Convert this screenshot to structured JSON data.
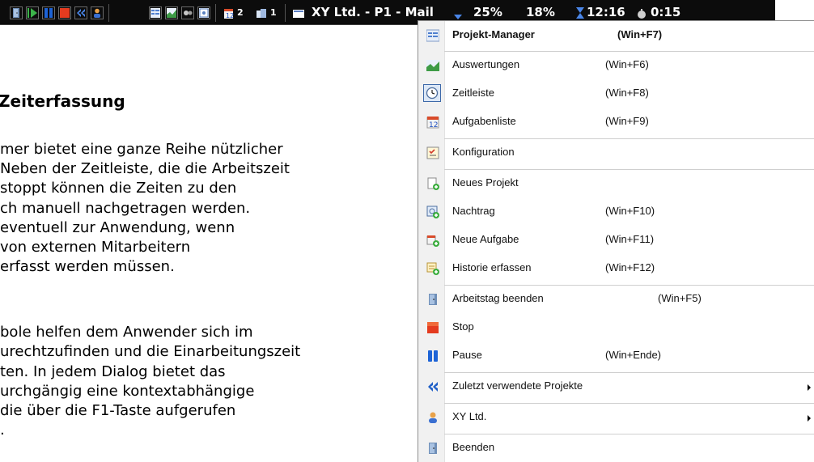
{
  "taskbar": {
    "buttons": [
      "door-icon",
      "play-icon",
      "pause-icon",
      "stop-icon",
      "rewind-icon",
      "person-icon",
      "project-manager-icon",
      "chart-icon",
      "tools-icon",
      "timeline-icon"
    ],
    "tasks_count": "2",
    "projects_count": "1",
    "project_title": "XY Ltd. - P1 - Mail",
    "percent_1": "25%",
    "percent_2": "18%",
    "clock_1": "12:16",
    "clock_2": "0:15"
  },
  "document": {
    "heading": "Zeiterfassung",
    "lines": [
      "mer bietet eine ganze Reihe nützlicher",
      "Neben der Zeitleiste, die die Arbeitszeit",
      "stoppt können die Zeiten zu den",
      "ch manuell nachgetragen werden.",
      "eventuell zur Anwendung, wenn",
      " von externen Mitarbeitern",
      "erfasst werden müssen.",
      "bole helfen dem Anwender sich im",
      "urechtzufinden und die Einarbeitungszeit",
      "ten. In jedem Dialog bietet das",
      "urchgängig eine kontextabhängige",
      " die über die F1-Taste aufgerufen",
      "."
    ]
  },
  "menu": {
    "items": [
      {
        "label": "Projekt-Manager",
        "shortcut": "(Win+F7)",
        "icon": "project-manager-icon",
        "bold": true
      },
      {
        "label": "Auswertungen",
        "shortcut": "(Win+F6)",
        "icon": "chart-icon"
      },
      {
        "label": "Zeitleiste",
        "shortcut": "(Win+F8)",
        "icon": "clock-icon"
      },
      {
        "label": "Aufgabenliste",
        "shortcut": "(Win+F9)",
        "icon": "task-list-icon"
      },
      {
        "label": "Konfiguration",
        "shortcut": "",
        "icon": "configuration-icon"
      },
      {
        "label": "Neues Projekt",
        "shortcut": "",
        "icon": "new-project-icon"
      },
      {
        "label": "Nachtrag",
        "shortcut": "(Win+F10)",
        "icon": "add-entry-icon"
      },
      {
        "label": "Neue Aufgabe",
        "shortcut": "(Win+F11)",
        "icon": "new-task-icon"
      },
      {
        "label": "Historie erfassen",
        "shortcut": "(Win+F12)",
        "icon": "history-icon"
      },
      {
        "label": "Arbeitstag beenden",
        "shortcut": "(Win+F5)",
        "icon": "door-icon"
      },
      {
        "label": "Stop",
        "shortcut": "",
        "icon": "stop-icon"
      },
      {
        "label": "Pause",
        "shortcut": "(Win+Ende)",
        "icon": "pause-icon"
      },
      {
        "label": "Zuletzt verwendete Projekte",
        "shortcut": "",
        "icon": "rewind-icon",
        "submenu": true
      },
      {
        "label": "XY Ltd.",
        "shortcut": "",
        "icon": "person-icon",
        "submenu": true
      },
      {
        "label": "Beenden",
        "shortcut": "",
        "icon": "door-icon"
      }
    ]
  },
  "colors": {
    "taskbar_bg": "#0c0c0c",
    "stop_red": "#e43b1f",
    "pause_blue": "#1d63d6",
    "rewind_blue": "#1f5fc7",
    "menu_gutter": "#f1f1f1",
    "menu_highlight_border": "#3c68a8"
  }
}
